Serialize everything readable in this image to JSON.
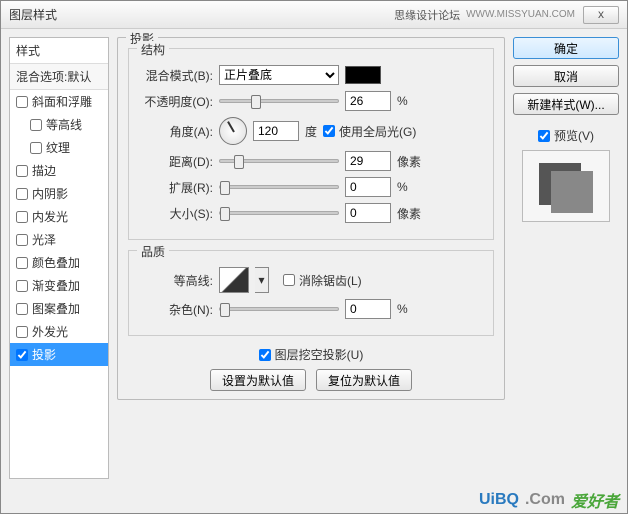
{
  "titlebar": {
    "title": "图层样式",
    "watermark": "思缘设计论坛",
    "url": "WWW.MISSYUAN.COM",
    "close": "x"
  },
  "sidebar": {
    "header": "样式",
    "sub": "混合选项:默认",
    "items": [
      {
        "label": "斜面和浮雕",
        "checked": false,
        "indent": false
      },
      {
        "label": "等高线",
        "checked": false,
        "indent": true
      },
      {
        "label": "纹理",
        "checked": false,
        "indent": true
      },
      {
        "label": "描边",
        "checked": false,
        "indent": false
      },
      {
        "label": "内阴影",
        "checked": false,
        "indent": false
      },
      {
        "label": "内发光",
        "checked": false,
        "indent": false
      },
      {
        "label": "光泽",
        "checked": false,
        "indent": false
      },
      {
        "label": "颜色叠加",
        "checked": false,
        "indent": false
      },
      {
        "label": "渐变叠加",
        "checked": false,
        "indent": false
      },
      {
        "label": "图案叠加",
        "checked": false,
        "indent": false
      },
      {
        "label": "外发光",
        "checked": false,
        "indent": false
      },
      {
        "label": "投影",
        "checked": true,
        "indent": false,
        "selected": true
      }
    ]
  },
  "main": {
    "title": "投影",
    "structure": {
      "title": "结构",
      "blend_label": "混合模式(B):",
      "blend_value": "正片叠底",
      "swatch": "#000000",
      "opacity_label": "不透明度(O):",
      "opacity_value": "26",
      "opacity_unit": "%",
      "angle_label": "角度(A):",
      "angle_value": "120",
      "angle_unit": "度",
      "global_light": "使用全局光(G)",
      "distance_label": "距离(D):",
      "distance_value": "29",
      "distance_unit": "像素",
      "spread_label": "扩展(R):",
      "spread_value": "0",
      "spread_unit": "%",
      "size_label": "大小(S):",
      "size_value": "0",
      "size_unit": "像素"
    },
    "quality": {
      "title": "品质",
      "contour_label": "等高线:",
      "antialias": "消除锯齿(L)",
      "noise_label": "杂色(N):",
      "noise_value": "0",
      "noise_unit": "%"
    },
    "knockout": "图层挖空投影(U)",
    "btn_default": "设置为默认值",
    "btn_reset": "复位为默认值"
  },
  "right": {
    "ok": "确定",
    "cancel": "取消",
    "newstyle": "新建样式(W)...",
    "preview": "预览(V)"
  },
  "footer": {
    "a": "UiBQ",
    "b": ".Com",
    "c": "爱好者"
  }
}
